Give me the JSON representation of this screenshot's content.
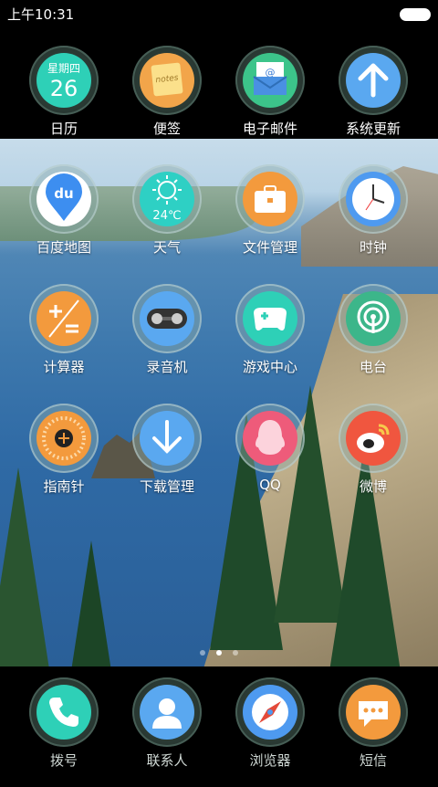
{
  "status_bar": {
    "time": "上午10:31"
  },
  "top_row": [
    {
      "id": "calendar",
      "label": "日历",
      "weekday": "星期四",
      "day": "26"
    },
    {
      "id": "notes",
      "label": "便签",
      "note_text": "notes"
    },
    {
      "id": "email",
      "label": "电子邮件"
    },
    {
      "id": "update",
      "label": "系统更新"
    }
  ],
  "grid": [
    {
      "id": "baidu-map",
      "label": "百度地图",
      "badge": "du"
    },
    {
      "id": "weather",
      "label": "天气",
      "temp": "24℃"
    },
    {
      "id": "files",
      "label": "文件管理"
    },
    {
      "id": "clock",
      "label": "时钟"
    },
    {
      "id": "calculator",
      "label": "计算器"
    },
    {
      "id": "recorder",
      "label": "录音机"
    },
    {
      "id": "game-center",
      "label": "游戏中心"
    },
    {
      "id": "radio",
      "label": "电台"
    },
    {
      "id": "compass",
      "label": "指南针"
    },
    {
      "id": "downloads",
      "label": "下载管理"
    },
    {
      "id": "qq",
      "label": "QQ"
    },
    {
      "id": "weibo",
      "label": "微博"
    }
  ],
  "dock": [
    {
      "id": "dialer",
      "label": "拨号"
    },
    {
      "id": "contacts",
      "label": "联系人"
    },
    {
      "id": "browser",
      "label": "浏览器"
    },
    {
      "id": "sms",
      "label": "短信"
    }
  ],
  "page_indicator": {
    "pages": 3,
    "current": 2
  }
}
